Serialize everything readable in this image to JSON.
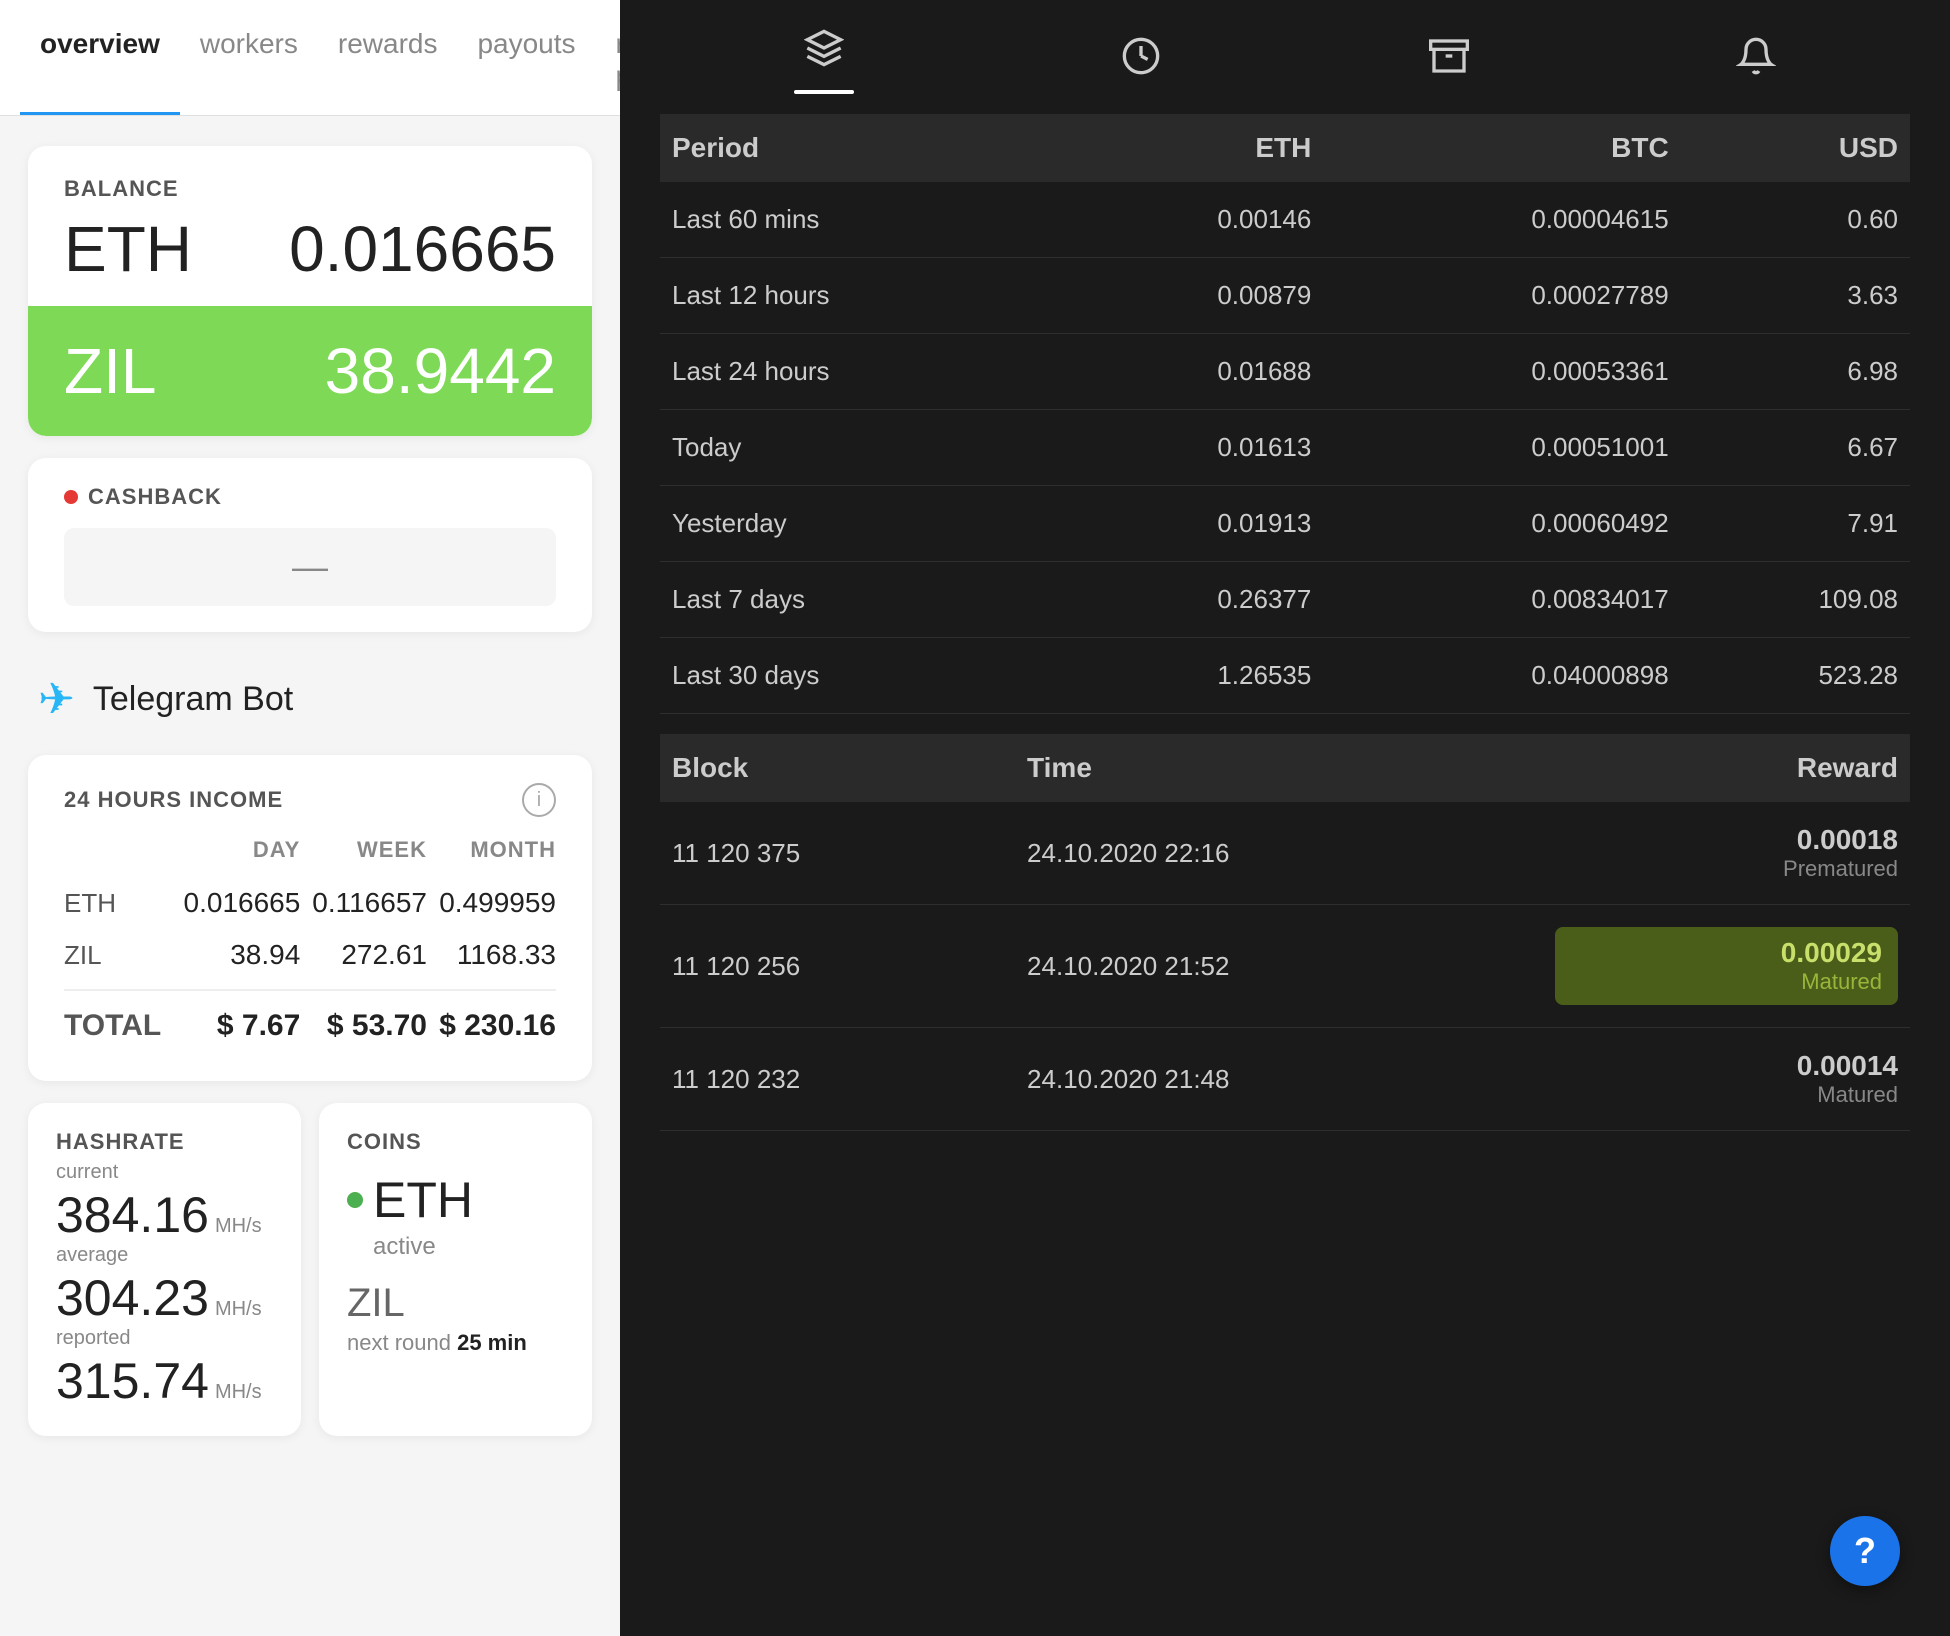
{
  "nav": {
    "tabs": [
      {
        "label": "overview",
        "active": true
      },
      {
        "label": "workers",
        "active": false
      },
      {
        "label": "rewards",
        "active": false
      },
      {
        "label": "payouts",
        "active": false
      },
      {
        "label": "referral program",
        "active": false
      }
    ]
  },
  "balance": {
    "label": "BALANCE",
    "eth_currency": "ETH",
    "eth_amount": "0.016665",
    "zil_currency": "ZIL",
    "zil_amount": "38.9442"
  },
  "cashback": {
    "label": "CASHBACK",
    "value": "—"
  },
  "telegram": {
    "label": "Telegram Bot"
  },
  "income": {
    "label": "24 HOURS INCOME",
    "col_day": "DAY",
    "col_week": "WEEK",
    "col_month": "MONTH",
    "rows": [
      {
        "label": "ETH",
        "day": "0.016665",
        "week": "0.116657",
        "month": "0.499959"
      },
      {
        "label": "ZIL",
        "day": "38.94",
        "week": "272.61",
        "month": "1168.33"
      },
      {
        "label": "TOTAL",
        "day": "$ 7.67",
        "week": "$ 53.70",
        "month": "$ 230.16"
      }
    ]
  },
  "hashrate": {
    "label": "HASHRATE",
    "current_label": "current",
    "current_value": "384.16",
    "current_unit": "MH/s",
    "average_label": "average",
    "average_value": "304.23",
    "average_unit": "MH/s",
    "reported_label": "reported",
    "reported_value": "315.74",
    "reported_unit": "MH/s"
  },
  "coins": {
    "label": "COINS",
    "eth_label": "ETH",
    "eth_status": "active",
    "zil_label": "ZIL",
    "zil_next": "next round",
    "zil_time": "25 min"
  },
  "right_header": {
    "icons": [
      "layers-icon",
      "timer-icon",
      "archive-icon",
      "bell-icon"
    ],
    "active_indicator": true
  },
  "stats_table": {
    "headers": [
      "Period",
      "ETH",
      "BTC",
      "USD"
    ],
    "rows": [
      {
        "period": "Last 60 mins",
        "eth": "0.00146",
        "btc": "0.00004615",
        "usd": "0.60"
      },
      {
        "period": "Last 12 hours",
        "eth": "0.00879",
        "btc": "0.00027789",
        "usd": "3.63"
      },
      {
        "period": "Last 24 hours",
        "eth": "0.01688",
        "btc": "0.00053361",
        "usd": "6.98"
      },
      {
        "period": "Today",
        "eth": "0.01613",
        "btc": "0.00051001",
        "usd": "6.67"
      },
      {
        "period": "Yesterday",
        "eth": "0.01913",
        "btc": "0.00060492",
        "usd": "7.91"
      },
      {
        "period": "Last 7 days",
        "eth": "0.26377",
        "btc": "0.00834017",
        "usd": "109.08"
      },
      {
        "period": "Last 30 days",
        "eth": "1.26535",
        "btc": "0.04000898",
        "usd": "523.28"
      }
    ]
  },
  "blocks_table": {
    "headers": [
      "Block",
      "Time",
      "Reward"
    ],
    "rows": [
      {
        "block": "11 120 375",
        "time": "24.10.2020 22:16",
        "reward": "0.00018",
        "status": "Prematured",
        "matured": false
      },
      {
        "block": "11 120 256",
        "time": "24.10.2020 21:52",
        "reward": "0.00029",
        "status": "Matured",
        "matured": true
      },
      {
        "block": "11 120 232",
        "time": "24.10.2020 21:48",
        "reward": "0.00014",
        "status": "Matured",
        "matured": false
      }
    ]
  },
  "help_fab": {
    "label": "?"
  }
}
